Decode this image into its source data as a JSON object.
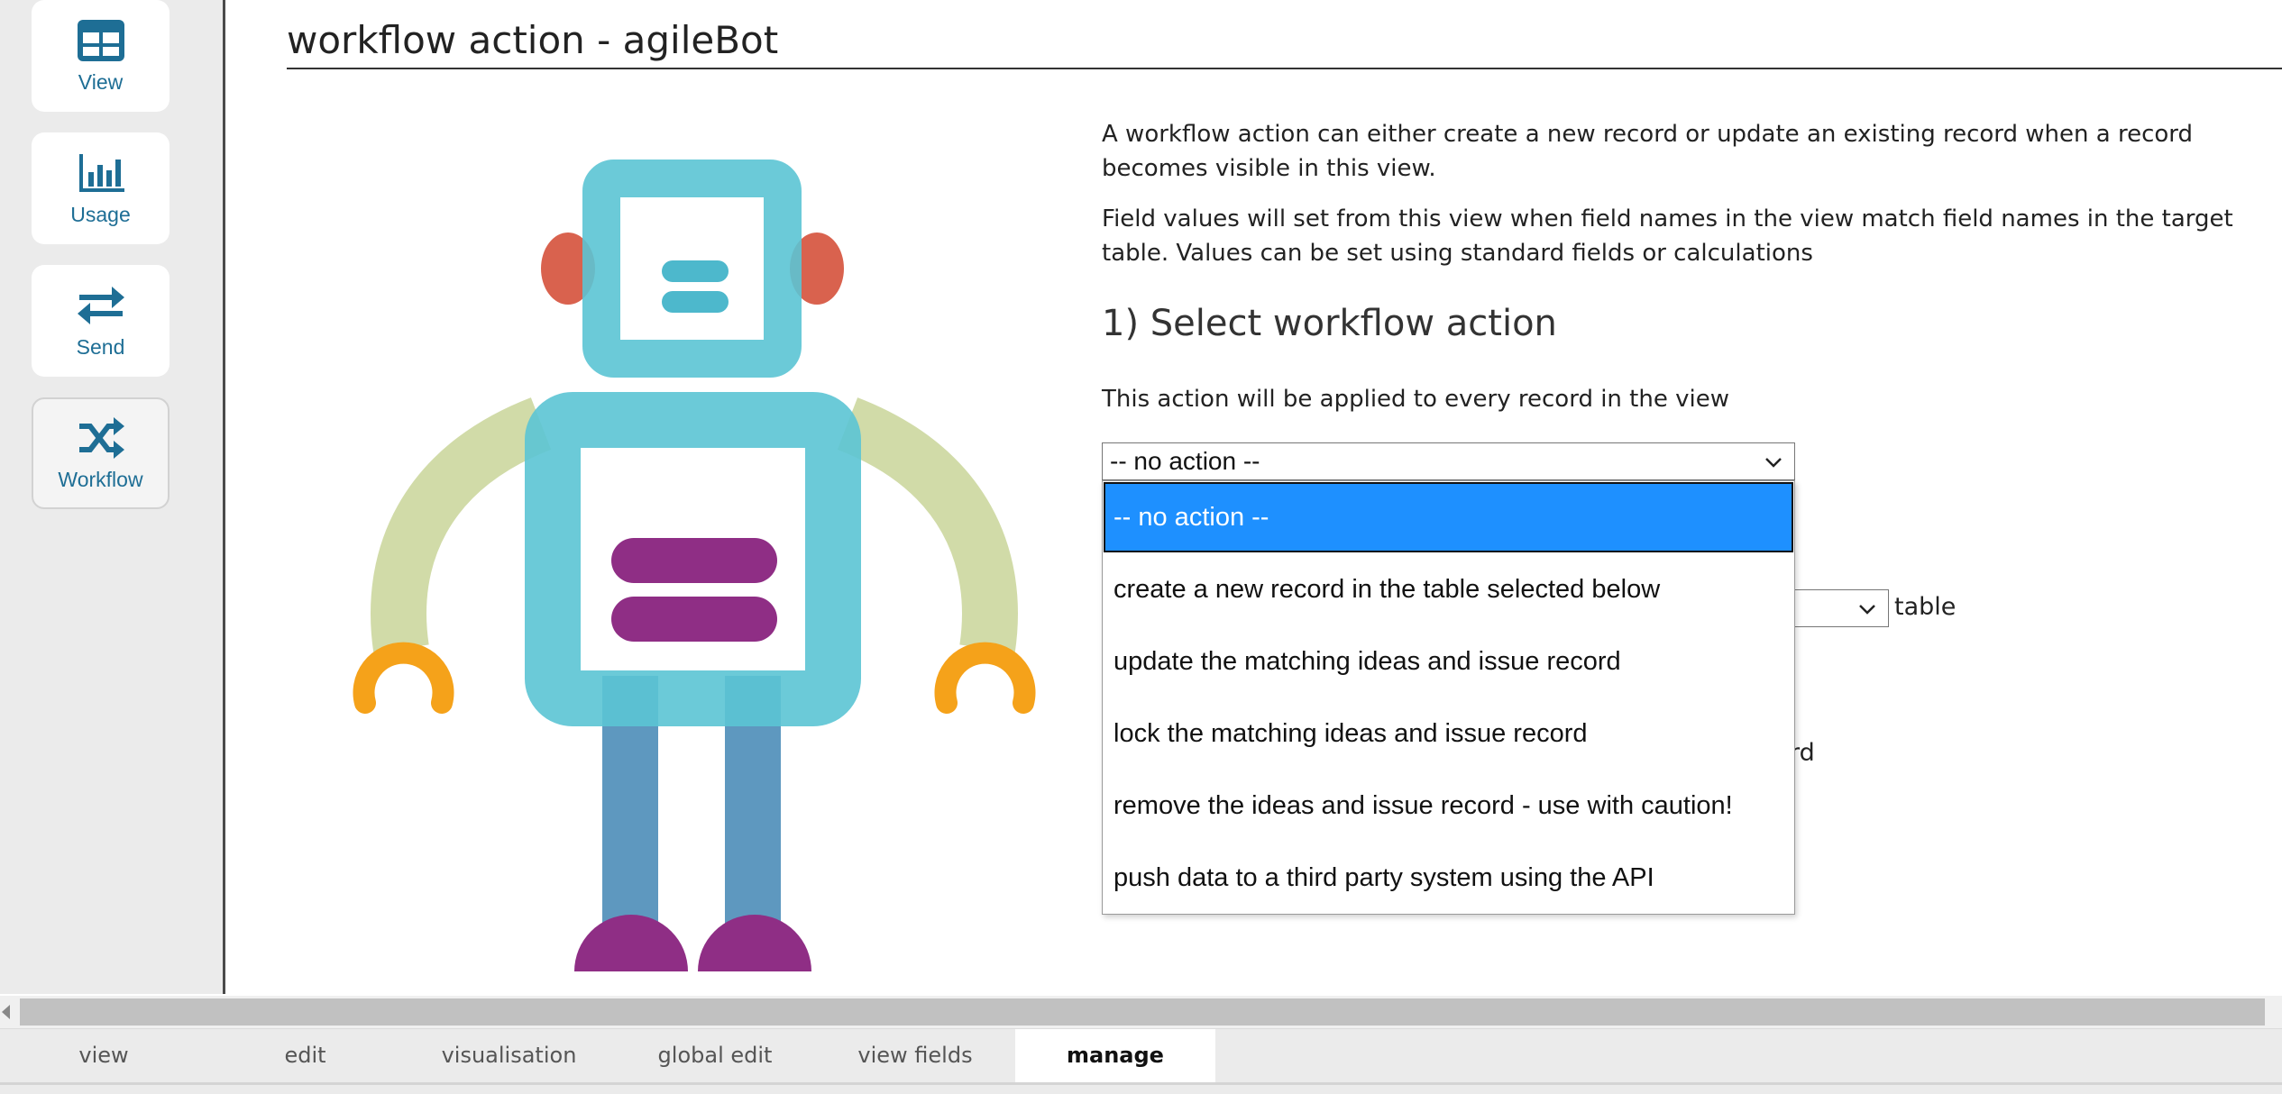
{
  "sidebar": {
    "items": [
      {
        "label": "View",
        "icon": "table-grid-icon"
      },
      {
        "label": "Usage",
        "icon": "bar-chart-icon"
      },
      {
        "label": "Send",
        "icon": "swap-arrows-icon"
      },
      {
        "label": "Workflow",
        "icon": "shuffle-icon"
      }
    ]
  },
  "page": {
    "title": "workflow action - agileBot"
  },
  "intro": {
    "para1": "A workflow action can either create a new record or update an existing record when a record becomes visible in this view.",
    "para2": "Field values will set from this view when field names in the view match field names in the target table. Values can be set using standard fields or calculations"
  },
  "step1": {
    "heading": "1) Select workflow action",
    "note": "This action will be applied to every record in the view",
    "selected_value": "-- no action --",
    "options": [
      "-- no action --",
      "create a new record in the table selected below",
      "update the matching ideas and issue record",
      "lock the matching ideas and issue record",
      "remove the ideas and issue record - use with caution!",
      "push data to a third party system using the API"
    ]
  },
  "obscured": {
    "table_label": "table",
    "record_fragment": "rd"
  },
  "tabs": [
    {
      "label": "view",
      "active": false
    },
    {
      "label": "edit",
      "active": false
    },
    {
      "label": "visualisation",
      "active": false
    },
    {
      "label": "global edit",
      "active": false
    },
    {
      "label": "view fields",
      "active": false
    },
    {
      "label": "manage",
      "active": true
    }
  ],
  "colors": {
    "accent": "#1e6e95",
    "selected_option": "#1e90ff",
    "robot_body": "#5bc4d4",
    "robot_arms": "#c9d599",
    "robot_hands": "#f5a21a",
    "robot_legs": "#4d8db8",
    "robot_feet": "#8f2e85",
    "robot_ears": "#d9624e"
  }
}
